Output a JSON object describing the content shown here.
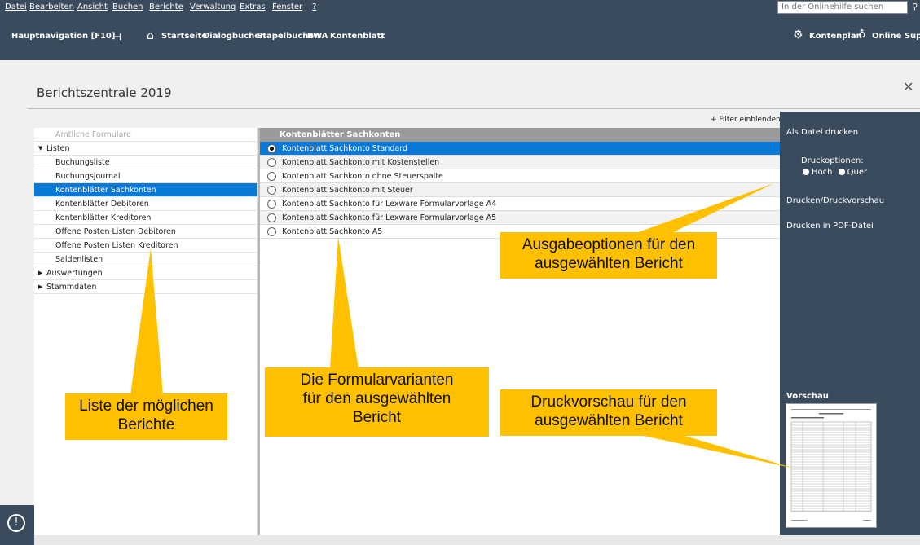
{
  "menu": [
    "Datei",
    "Bearbeiten",
    "Ansicht",
    "Buchen",
    "Berichte",
    "Verwaltung",
    "Extras",
    "Fenster",
    "?"
  ],
  "help_search_placeholder": "In der Onlinehilfe suchen",
  "nav": {
    "main": "Hauptnavigation [F10]",
    "items": [
      "Startseite",
      "Dialogbuchen",
      "Stapelbuchen",
      "BWA",
      "Kontenblatt"
    ],
    "right": [
      "Kontenplan",
      "Online Suppo"
    ]
  },
  "page_title": "Berichtszentrale 2019",
  "filter_link": "+ Filter einblenden",
  "tree": [
    {
      "label": "Amtliche Formulare",
      "indent": 0,
      "state": "dim"
    },
    {
      "label": "Listen",
      "indent": 0,
      "arrow": "down"
    },
    {
      "label": "Buchungsliste",
      "indent": 1
    },
    {
      "label": "Buchungsjournal",
      "indent": 1
    },
    {
      "label": "Kontenblätter Sachkonten",
      "indent": 1,
      "state": "sel"
    },
    {
      "label": "Kontenblätter Debitoren",
      "indent": 1
    },
    {
      "label": "Kontenblätter Kreditoren",
      "indent": 1
    },
    {
      "label": "Offene Posten Listen Debitoren",
      "indent": 1
    },
    {
      "label": "Offene Posten Listen Kreditoren",
      "indent": 1
    },
    {
      "label": "Saldenlisten",
      "indent": 1
    },
    {
      "label": "Auswertungen",
      "indent": 0,
      "arrow": "right"
    },
    {
      "label": "Stammdaten",
      "indent": 0,
      "arrow": "right"
    }
  ],
  "list_header": "Kontenblätter Sachkonten",
  "list": [
    {
      "label": "Kontenblatt Sachkonto Standard",
      "selected": true
    },
    {
      "label": "Kontenblatt Sachkonto mit Kostenstellen"
    },
    {
      "label": "Kontenblatt Sachkonto ohne Steuerspalte"
    },
    {
      "label": "Kontenblatt Sachkonto mit Steuer"
    },
    {
      "label": "Kontenblatt Sachkonto für Lexware Formularvorlage A4"
    },
    {
      "label": "Kontenblatt Sachkonto für Lexware Formularvorlage A5"
    },
    {
      "label": "Kontenblatt Sachkonto A5"
    }
  ],
  "right_panel": {
    "als_datei": "Als Datei drucken",
    "druckoptionen": "Druckoptionen:",
    "hoch": "Hoch",
    "quer": "Quer",
    "drucken": "Drucken/Druckvorschau",
    "pdf": "Drucken in PDF-Datei",
    "vorschau": "Vorschau"
  },
  "callouts": {
    "ausgabe": [
      "Ausgabeoptionen für den",
      "ausgewählten Bericht"
    ],
    "liste": [
      "Liste der möglichen",
      "Berichte"
    ],
    "formular": [
      "Die Formularvarianten",
      "für den ausgewählten",
      "Bericht"
    ],
    "vorschau": [
      "Druckvorschau für den",
      "ausgewählten Bericht"
    ]
  },
  "colors": {
    "dark": "#3b4b5e",
    "select": "#0a78d7",
    "callout": "#ffc000"
  },
  "alert_icon": "!"
}
